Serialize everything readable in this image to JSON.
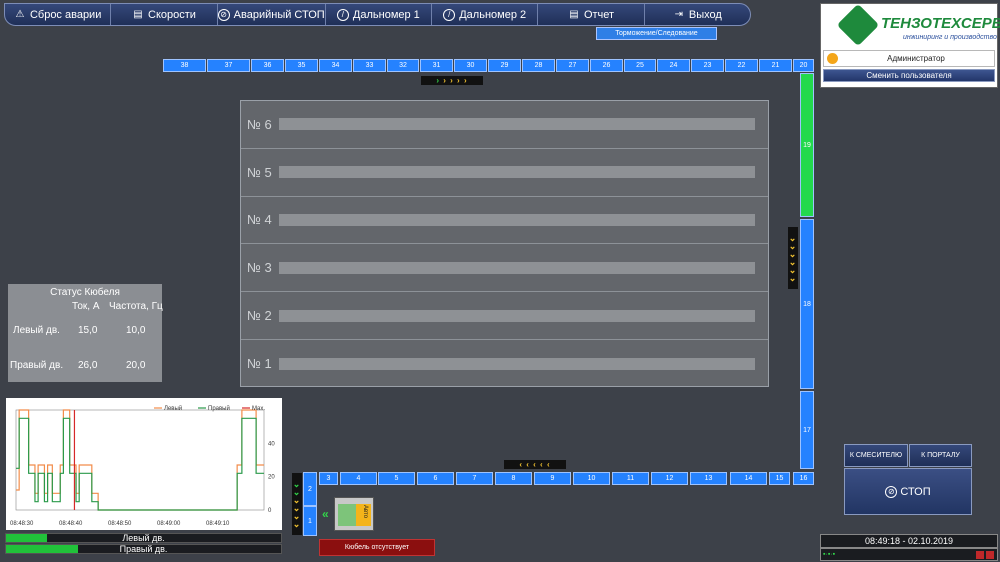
{
  "toolbar": {
    "reset": "Сброс аварии",
    "speeds": "Скорости",
    "estop": "Аварийный СТОП",
    "range1": "Дальномер 1",
    "range2": "Дальномер 2",
    "report": "Отчет",
    "exit": "Выход"
  },
  "mode_label": "Торможение/Следование",
  "top_track": [
    "38",
    "37",
    "36",
    "35",
    "34",
    "33",
    "32",
    "31",
    "30",
    "29",
    "28",
    "27",
    "26",
    "25",
    "24",
    "23",
    "22",
    "21",
    "20"
  ],
  "right_track": [
    "19",
    "18",
    "17"
  ],
  "bottom_track": [
    "16",
    "15",
    "14",
    "13",
    "12",
    "11",
    "10",
    "9",
    "8",
    "7",
    "6",
    "5",
    "4",
    "3"
  ],
  "left_track": [
    "2",
    "1"
  ],
  "stacks": [
    "№ 6",
    "№ 5",
    "№ 4",
    "№ 3",
    "№ 2",
    "№ 1"
  ],
  "status": {
    "title": "Статус Кюбеля",
    "col_current": "Ток, А",
    "col_freq": "Частота, Гц",
    "rows": [
      {
        "label": "Левый дв.",
        "current": "15,0",
        "freq": "10,0"
      },
      {
        "label": "Правый дв.",
        "current": "26,0",
        "freq": "20,0"
      }
    ]
  },
  "chart_data": {
    "type": "line",
    "x_ticks": [
      "08:48:30",
      "08:48:40",
      "08:48:50",
      "08:49:00",
      "08:49:10"
    ],
    "y_ticks": [
      "0",
      "20",
      "40"
    ],
    "ylim": [
      0,
      60
    ],
    "legend": [
      "Левый",
      "Правый",
      "Max."
    ],
    "colors": {
      "left": "#f28c4a",
      "right": "#2a9a4a",
      "max": "#d62828"
    },
    "series": [
      {
        "name": "Левый",
        "values": [
          [
            0,
            12
          ],
          [
            2,
            12
          ],
          [
            2,
            60
          ],
          [
            8,
            60
          ],
          [
            8,
            27
          ],
          [
            12,
            27
          ],
          [
            12,
            10
          ],
          [
            14,
            10
          ],
          [
            14,
            27
          ],
          [
            18,
            27
          ],
          [
            18,
            10
          ],
          [
            20,
            10
          ],
          [
            20,
            27
          ],
          [
            23,
            27
          ],
          [
            23,
            10
          ],
          [
            28,
            10
          ],
          [
            28,
            27
          ],
          [
            30,
            27
          ],
          [
            30,
            60
          ],
          [
            34,
            60
          ],
          [
            34,
            27
          ],
          [
            38,
            27
          ],
          [
            38,
            10
          ],
          [
            40,
            10
          ],
          [
            40,
            27
          ],
          [
            48,
            27
          ],
          [
            48,
            10
          ],
          [
            52,
            10
          ],
          [
            52,
            0
          ],
          [
            140,
            0
          ],
          [
            140,
            27
          ],
          [
            143,
            27
          ],
          [
            143,
            60
          ],
          [
            152,
            60
          ],
          [
            152,
            27
          ],
          [
            157,
            27
          ]
        ]
      },
      {
        "name": "Правый",
        "values": [
          [
            0,
            25
          ],
          [
            2,
            25
          ],
          [
            2,
            55
          ],
          [
            8,
            55
          ],
          [
            8,
            22
          ],
          [
            12,
            22
          ],
          [
            12,
            5
          ],
          [
            14,
            5
          ],
          [
            14,
            22
          ],
          [
            18,
            22
          ],
          [
            18,
            5
          ],
          [
            20,
            5
          ],
          [
            20,
            22
          ],
          [
            23,
            22
          ],
          [
            23,
            5
          ],
          [
            28,
            5
          ],
          [
            28,
            22
          ],
          [
            30,
            22
          ],
          [
            30,
            55
          ],
          [
            34,
            55
          ],
          [
            34,
            22
          ],
          [
            38,
            22
          ],
          [
            38,
            5
          ],
          [
            40,
            5
          ],
          [
            40,
            22
          ],
          [
            48,
            22
          ],
          [
            48,
            5
          ],
          [
            52,
            5
          ],
          [
            52,
            0
          ],
          [
            140,
            0
          ],
          [
            140,
            22
          ],
          [
            143,
            22
          ],
          [
            143,
            55
          ],
          [
            152,
            55
          ],
          [
            152,
            22
          ],
          [
            157,
            22
          ]
        ]
      },
      {
        "name": "Max.",
        "values": [
          [
            37,
            0
          ],
          [
            37,
            60
          ]
        ]
      }
    ]
  },
  "meters": {
    "left": {
      "label": "Левый дв.",
      "fill": 0.15
    },
    "right": {
      "label": "Правый дв.",
      "fill": 0.26
    }
  },
  "logo": {
    "name": "ТЕНЗОТЕХСЕРВИС",
    "tagline": "инжиниринг и производство"
  },
  "user": {
    "role": "Администратор",
    "change": "Сменить пользователя"
  },
  "right_buttons": {
    "to_mixer": "К СМЕСИТЕЛЮ",
    "to_portal": "К ПОРТАЛУ",
    "stop": "СТОП"
  },
  "datetime": "08:49:18 - 02.10.2019",
  "bucket": {
    "label": "Авто",
    "absent": "Кюбель отсутствует"
  },
  "arrows": {
    "right": "› › › ›",
    "left": "‹ ‹ ‹ ‹ ‹",
    "down": "⌄"
  }
}
